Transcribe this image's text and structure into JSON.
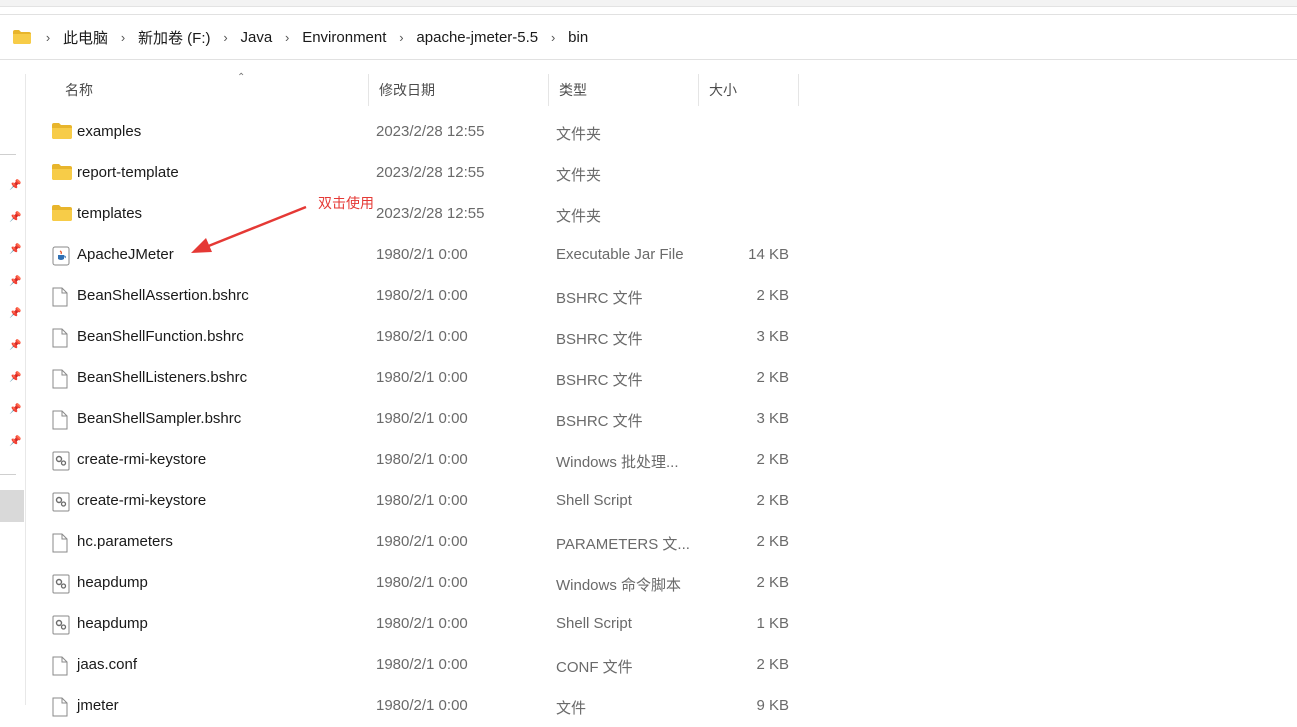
{
  "breadcrumb": [
    "此电脑",
    "新加卷 (F:)",
    "Java",
    "Environment",
    "apache-jmeter-5.5",
    "bin"
  ],
  "columns": {
    "name": "名称",
    "date": "修改日期",
    "type": "类型",
    "size": "大小"
  },
  "files": [
    {
      "name": "examples",
      "date": "2023/2/28 12:55",
      "type": "文件夹",
      "size": "",
      "icon": "folder-icon"
    },
    {
      "name": "report-template",
      "date": "2023/2/28 12:55",
      "type": "文件夹",
      "size": "",
      "icon": "folder-icon"
    },
    {
      "name": "templates",
      "date": "2023/2/28 12:55",
      "type": "文件夹",
      "size": "",
      "icon": "folder-icon"
    },
    {
      "name": "ApacheJMeter",
      "date": "1980/2/1 0:00",
      "type": "Executable Jar File",
      "size": "14 KB",
      "icon": "java-jar-icon"
    },
    {
      "name": "BeanShellAssertion.bshrc",
      "date": "1980/2/1 0:00",
      "type": "BSHRC 文件",
      "size": "2 KB",
      "icon": "file-icon"
    },
    {
      "name": "BeanShellFunction.bshrc",
      "date": "1980/2/1 0:00",
      "type": "BSHRC 文件",
      "size": "3 KB",
      "icon": "file-icon"
    },
    {
      "name": "BeanShellListeners.bshrc",
      "date": "1980/2/1 0:00",
      "type": "BSHRC 文件",
      "size": "2 KB",
      "icon": "file-icon"
    },
    {
      "name": "BeanShellSampler.bshrc",
      "date": "1980/2/1 0:00",
      "type": "BSHRC 文件",
      "size": "3 KB",
      "icon": "file-icon"
    },
    {
      "name": "create-rmi-keystore",
      "date": "1980/2/1 0:00",
      "type": "Windows 批处理...",
      "size": "2 KB",
      "icon": "script-icon"
    },
    {
      "name": "create-rmi-keystore",
      "date": "1980/2/1 0:00",
      "type": "Shell Script",
      "size": "2 KB",
      "icon": "script-icon"
    },
    {
      "name": "hc.parameters",
      "date": "1980/2/1 0:00",
      "type": "PARAMETERS 文...",
      "size": "2 KB",
      "icon": "file-icon"
    },
    {
      "name": "heapdump",
      "date": "1980/2/1 0:00",
      "type": "Windows 命令脚本",
      "size": "2 KB",
      "icon": "script-icon"
    },
    {
      "name": "heapdump",
      "date": "1980/2/1 0:00",
      "type": "Shell Script",
      "size": "1 KB",
      "icon": "script-icon"
    },
    {
      "name": "jaas.conf",
      "date": "1980/2/1 0:00",
      "type": "CONF 文件",
      "size": "2 KB",
      "icon": "file-icon"
    },
    {
      "name": "jmeter",
      "date": "1980/2/1 0:00",
      "type": "文件",
      "size": "9 KB",
      "icon": "file-icon"
    }
  ],
  "annotation": {
    "text": "双击使用",
    "color": "#e53935"
  },
  "colors": {
    "folder": "#f4c430",
    "accent": "#e53935"
  }
}
